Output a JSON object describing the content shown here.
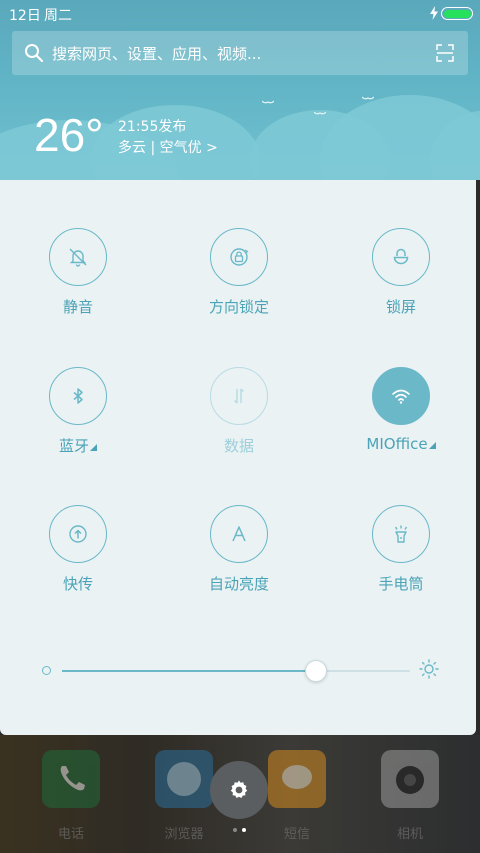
{
  "status_bar": {
    "date": "12日",
    "weekday": "周二",
    "battery_level": 1.0
  },
  "search": {
    "placeholder": "搜索网页、设置、应用、视频..."
  },
  "weather": {
    "temperature": "26°",
    "publish_time": "21:55发布",
    "description": "多云 | 空气优 >"
  },
  "toggles": [
    {
      "label": "静音",
      "icon": "mute-bell-icon",
      "state": "off"
    },
    {
      "label": "方向锁定",
      "icon": "rotation-lock-icon",
      "state": "off"
    },
    {
      "label": "锁屏",
      "icon": "lock-icon",
      "state": "off"
    },
    {
      "label": "蓝牙",
      "icon": "bluetooth-icon",
      "state": "off",
      "has_menu": true
    },
    {
      "label": "数据",
      "icon": "mobile-data-icon",
      "state": "disabled"
    },
    {
      "label": "MIOffice",
      "icon": "wifi-icon",
      "state": "on",
      "has_menu": true
    },
    {
      "label": "快传",
      "icon": "quick-transfer-icon",
      "state": "off"
    },
    {
      "label": "自动亮度",
      "icon": "auto-brightness-icon",
      "state": "off"
    },
    {
      "label": "手电筒",
      "icon": "flashlight-icon",
      "state": "off"
    }
  ],
  "brightness": {
    "level": 0.73
  },
  "dock": {
    "apps": [
      "电话",
      "浏览器",
      "短信",
      "相机"
    ],
    "page_count": 2,
    "current_page": 2
  },
  "colors": {
    "accent": "#6ab8c8",
    "label": "#4aa3b6",
    "panel_bg": "#eaf2f4",
    "header_bg": "#5fb3c4"
  }
}
